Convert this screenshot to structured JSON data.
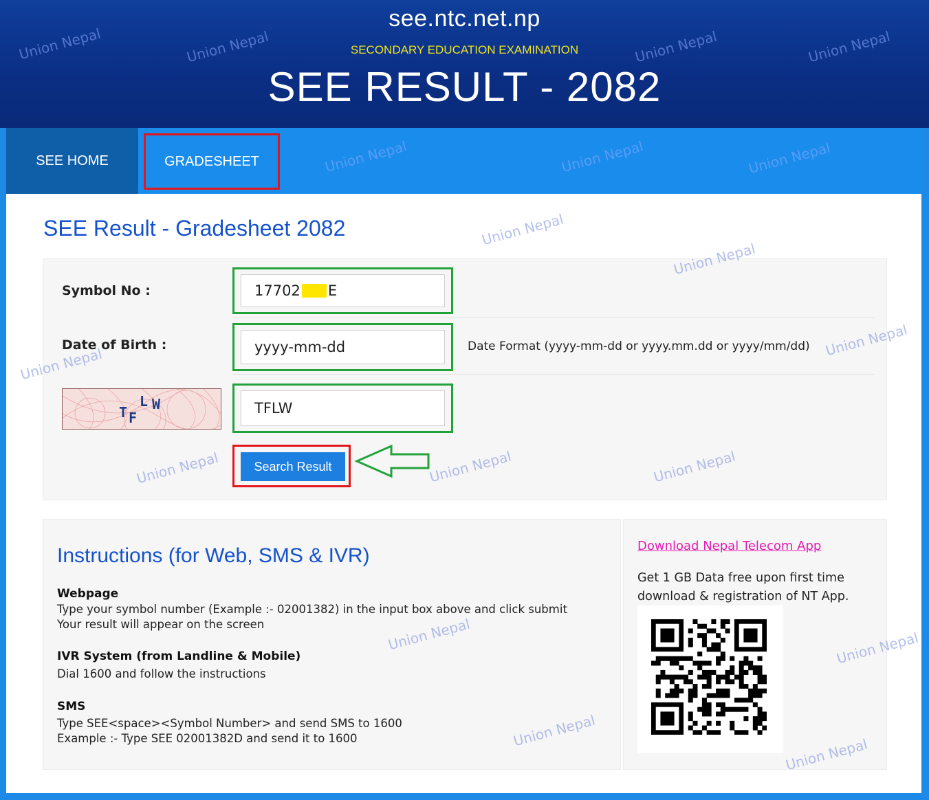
{
  "header": {
    "site": "see.ntc.net.np",
    "subtitle": "SECONDARY EDUCATION EXAMINATION",
    "title": "SEE RESULT - 2082"
  },
  "nav": {
    "home_label": "SEE HOME",
    "gradesheet_label": "GRADESHEET"
  },
  "form": {
    "heading": "SEE Result - Gradesheet 2082",
    "symbol_label": "Symbol No :",
    "symbol_value_prefix": "17702",
    "symbol_value_suffix": "E",
    "dob_label": "Date of Birth :",
    "dob_placeholder": "yyyy-mm-dd",
    "dob_hint": "Date Format (yyyy-mm-dd or yyyy.mm.dd or yyyy/mm/dd)",
    "captcha_text": "TFLW",
    "captcha_value": "TFLW",
    "submit_label": "Search Result"
  },
  "instructions": {
    "heading": "Instructions (for Web, SMS & IVR)",
    "web_title": "Webpage",
    "web_line1": "Type your symbol number  (Example :- 02001382) in the input box above and click submit",
    "web_line2": "Your result will appear on the screen",
    "ivr_title": "IVR System (from Landline & Mobile)",
    "ivr_line1": "Dial 1600 and follow the instructions",
    "sms_title": "SMS",
    "sms_line1": "Type SEE<space><Symbol Number> and send SMS to 1600",
    "sms_line2": "Example :- Type SEE  02001382D and send it to 1600"
  },
  "sidebar": {
    "download_link": "Download Nepal Telecom App",
    "promo_text": "Get 1 GB Data free upon first time download & registration of NT App."
  },
  "watermark": "Union Nepal",
  "colors": {
    "header_bg": "#0b2f86",
    "nav_bg": "#1a8cec",
    "home_tab_bg": "#0f5ea8",
    "accent_blue": "#1552cc",
    "highlight_red": "#e3161b",
    "highlight_green": "#22a33a",
    "link_magenta": "#e31cb6",
    "subtitle_yellow": "#f0e41a"
  },
  "icons": {
    "arrow": "left-arrow-outline-icon",
    "qr": "qr-code-icon",
    "captcha": "captcha-image"
  }
}
